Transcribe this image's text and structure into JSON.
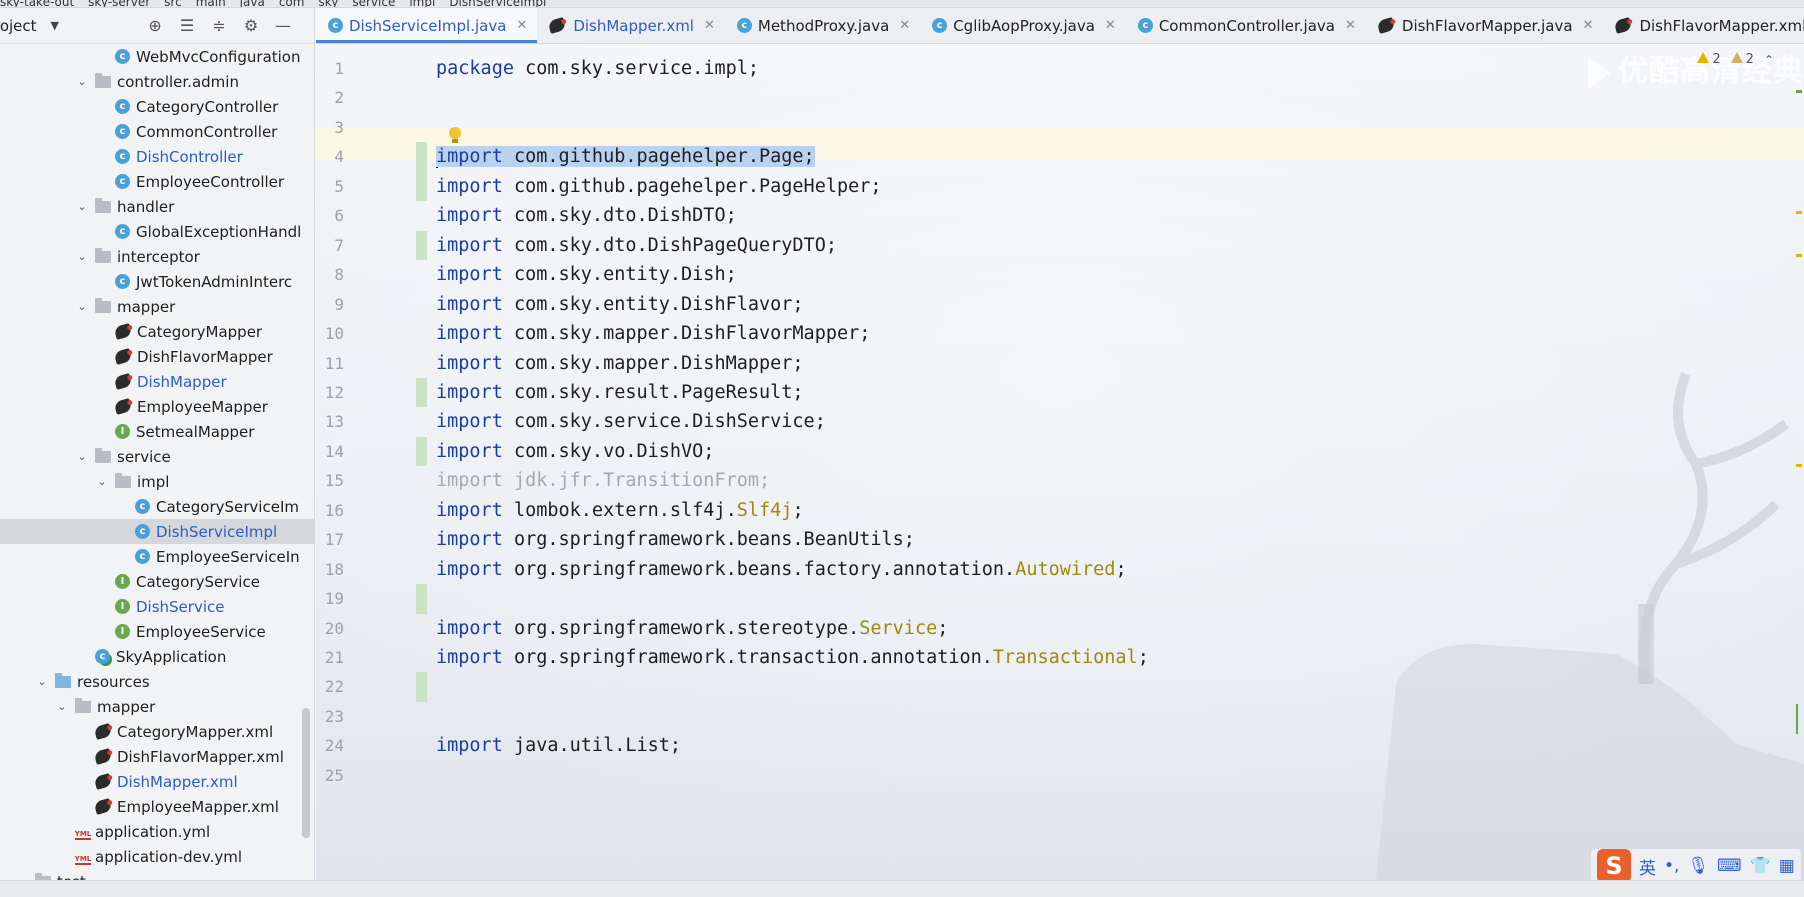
{
  "breadcrumb": [
    "sky-take-out",
    "sky-server",
    "src",
    "main",
    "java",
    "com",
    "sky",
    "service",
    "impl",
    "DishServiceImpl"
  ],
  "project_panel": {
    "title": "roject",
    "tree": [
      {
        "label": "WebMvcConfiguration",
        "type": "class",
        "indent": 115
      },
      {
        "label": "controller.admin",
        "type": "folder",
        "indent": 95,
        "chevron": "v"
      },
      {
        "label": "CategoryController",
        "type": "class",
        "indent": 115
      },
      {
        "label": "CommonController",
        "type": "class",
        "indent": 115
      },
      {
        "label": "DishController",
        "type": "class",
        "indent": 115,
        "blue": true
      },
      {
        "label": "EmployeeController",
        "type": "class",
        "indent": 115
      },
      {
        "label": "handler",
        "type": "folder",
        "indent": 95,
        "chevron": "v"
      },
      {
        "label": "GlobalExceptionHandl",
        "type": "class",
        "indent": 115
      },
      {
        "label": "interceptor",
        "type": "folder",
        "indent": 95,
        "chevron": "v"
      },
      {
        "label": "JwtTokenAdminInterc",
        "type": "class",
        "indent": 115
      },
      {
        "label": "mapper",
        "type": "folder",
        "indent": 95,
        "chevron": "v"
      },
      {
        "label": "CategoryMapper",
        "type": "mybatis",
        "indent": 115
      },
      {
        "label": "DishFlavorMapper",
        "type": "mybatis",
        "indent": 115
      },
      {
        "label": "DishMapper",
        "type": "mybatis",
        "indent": 115,
        "blue": true
      },
      {
        "label": "EmployeeMapper",
        "type": "mybatis",
        "indent": 115
      },
      {
        "label": "SetmealMapper",
        "type": "iface",
        "indent": 115
      },
      {
        "label": "service",
        "type": "folder",
        "indent": 95,
        "chevron": "v"
      },
      {
        "label": "impl",
        "type": "folder",
        "indent": 115,
        "chevron": "v"
      },
      {
        "label": "CategoryServiceIm",
        "type": "class",
        "indent": 135
      },
      {
        "label": "DishServiceImpl",
        "type": "class",
        "indent": 135,
        "blue": true,
        "selected": true
      },
      {
        "label": "EmployeeServiceIn",
        "type": "class",
        "indent": 135
      },
      {
        "label": "CategoryService",
        "type": "iface",
        "indent": 115
      },
      {
        "label": "DishService",
        "type": "iface",
        "indent": 115,
        "blue": true
      },
      {
        "label": "EmployeeService",
        "type": "iface",
        "indent": 115
      },
      {
        "label": "SkyApplication",
        "type": "app",
        "indent": 95
      },
      {
        "label": "resources",
        "type": "res-folder",
        "indent": 55,
        "chevron": "v"
      },
      {
        "label": "mapper",
        "type": "folder",
        "indent": 75,
        "chevron": "v"
      },
      {
        "label": "CategoryMapper.xml",
        "type": "mybatis",
        "indent": 95
      },
      {
        "label": "DishFlavorMapper.xml",
        "type": "mybatis",
        "indent": 95
      },
      {
        "label": "DishMapper.xml",
        "type": "mybatis",
        "indent": 95,
        "blue": true
      },
      {
        "label": "EmployeeMapper.xml",
        "type": "mybatis",
        "indent": 95
      },
      {
        "label": "application.yml",
        "type": "yml",
        "indent": 75
      },
      {
        "label": "application-dev.yml",
        "type": "yml",
        "indent": 75
      },
      {
        "label": "test",
        "type": "folder",
        "indent": 35,
        "chevron": ">"
      }
    ]
  },
  "tabs": [
    {
      "label": "DishServiceImpl.java",
      "icon": "class",
      "active": true,
      "blue": true
    },
    {
      "label": "DishMapper.xml",
      "icon": "mybatis",
      "blue": true
    },
    {
      "label": "MethodProxy.java",
      "icon": "class"
    },
    {
      "label": "CglibAopProxy.java",
      "icon": "class"
    },
    {
      "label": "CommonController.java",
      "icon": "class"
    },
    {
      "label": "DishFlavorMapper.java",
      "icon": "mybatis"
    },
    {
      "label": "DishFlavorMapper.xml",
      "icon": "mybatis"
    }
  ],
  "editor": {
    "warnings_count": "2",
    "weak_warnings_count": "2",
    "watermark": "优酷高清经典",
    "lines": [
      {
        "num": "1",
        "segments": [
          {
            "t": "package",
            "c": "kw"
          },
          {
            "t": " com.sky.service.impl;"
          }
        ]
      },
      {
        "num": "2",
        "segments": []
      },
      {
        "num": "3",
        "segments": []
      },
      {
        "num": "4",
        "segments": [
          {
            "t": "import",
            "c": "kw sel"
          },
          {
            "t": " com.github.pagehelper.Page;",
            "c": "sel"
          }
        ],
        "current": true,
        "caret": true
      },
      {
        "num": "5",
        "segments": [
          {
            "t": "import",
            "c": "kw"
          },
          {
            "t": " com.github.pagehelper.PageHelper;"
          }
        ]
      },
      {
        "num": "6",
        "segments": [
          {
            "t": "import",
            "c": "kw"
          },
          {
            "t": " com.sky.dto.DishDTO;"
          }
        ]
      },
      {
        "num": "7",
        "segments": [
          {
            "t": "import",
            "c": "kw"
          },
          {
            "t": " com.sky.dto.DishPageQueryDTO;"
          }
        ]
      },
      {
        "num": "8",
        "segments": [
          {
            "t": "import",
            "c": "kw"
          },
          {
            "t": " com.sky.entity.Dish;"
          }
        ]
      },
      {
        "num": "9",
        "segments": [
          {
            "t": "import",
            "c": "kw"
          },
          {
            "t": " com.sky.entity.DishFlavor;"
          }
        ]
      },
      {
        "num": "10",
        "segments": [
          {
            "t": "import",
            "c": "kw"
          },
          {
            "t": " com.sky.mapper.DishFlavorMapper;"
          }
        ]
      },
      {
        "num": "11",
        "segments": [
          {
            "t": "import",
            "c": "kw"
          },
          {
            "t": " com.sky.mapper.DishMapper;"
          }
        ]
      },
      {
        "num": "12",
        "segments": [
          {
            "t": "import",
            "c": "kw"
          },
          {
            "t": " com.sky.result.PageResult;"
          }
        ]
      },
      {
        "num": "13",
        "segments": [
          {
            "t": "import",
            "c": "kw"
          },
          {
            "t": " com.sky.service.DishService;"
          }
        ]
      },
      {
        "num": "14",
        "segments": [
          {
            "t": "import",
            "c": "kw"
          },
          {
            "t": " com.sky.vo.DishVO;"
          }
        ]
      },
      {
        "num": "15",
        "segments": [
          {
            "t": "import jdk.jfr.TransitionFrom;",
            "c": "unused"
          }
        ]
      },
      {
        "num": "16",
        "segments": [
          {
            "t": "import",
            "c": "kw"
          },
          {
            "t": " lombok.extern.slf4j."
          },
          {
            "t": "Slf4j",
            "c": "ann"
          },
          {
            "t": ";"
          }
        ]
      },
      {
        "num": "17",
        "segments": [
          {
            "t": "import",
            "c": "kw"
          },
          {
            "t": " org.springframework.beans.BeanUtils;"
          }
        ]
      },
      {
        "num": "18",
        "segments": [
          {
            "t": "import",
            "c": "kw"
          },
          {
            "t": " org.springframework.beans.factory.annotation."
          },
          {
            "t": "Autowired",
            "c": "ann"
          },
          {
            "t": ";"
          }
        ]
      },
      {
        "num": "19",
        "segments": []
      },
      {
        "num": "20",
        "segments": [
          {
            "t": "import",
            "c": "kw"
          },
          {
            "t": " org.springframework.stereotype."
          },
          {
            "t": "Service",
            "c": "ann"
          },
          {
            "t": ";"
          }
        ]
      },
      {
        "num": "21",
        "segments": [
          {
            "t": "import",
            "c": "kw"
          },
          {
            "t": " org.springframework.transaction.annotation."
          },
          {
            "t": "Transactional",
            "c": "ann"
          },
          {
            "t": ";"
          }
        ]
      },
      {
        "num": "22",
        "segments": []
      },
      {
        "num": "23",
        "segments": []
      },
      {
        "num": "24",
        "segments": [
          {
            "t": "import",
            "c": "kw"
          },
          {
            "t": " java.util.List;"
          }
        ]
      },
      {
        "num": "25",
        "segments": []
      }
    ]
  },
  "ime": {
    "lang": "英",
    "punct": "•,"
  },
  "colors": {
    "keyword": "#1a3d9e",
    "annotation": "#9e880d",
    "selection": "#b8d2f0",
    "link_blue": "#2d5dbf"
  }
}
